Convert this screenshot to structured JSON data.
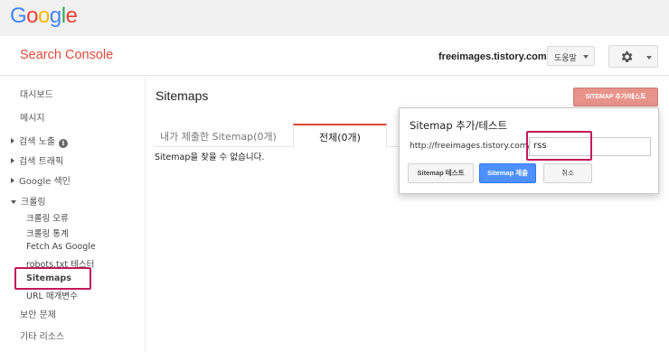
{
  "logo": {
    "letters": [
      "G",
      "o",
      "o",
      "g",
      "l",
      "e"
    ]
  },
  "colors": {
    "accent": "#dd4b39",
    "primary_button": "#4d90fe",
    "highlight": "#c2185b"
  },
  "header": {
    "app_title": "Search Console",
    "site": "freeimages.tistory.com",
    "help_label": "도움말",
    "settings_icon": "gear-icon"
  },
  "sidebar": {
    "dashboard": "대시보드",
    "messages": "메시지",
    "search_appearance": "검색 노출",
    "search_traffic": "검색 트래픽",
    "google_index": "Google 색인",
    "crawl": "크롤링",
    "crawl_errors": "크롤링 오류",
    "crawl_stats": "크롤링 통계",
    "fetch_as_google": "Fetch As Google",
    "robots_tester": "robots.txt 테스터",
    "sitemaps": "Sitemaps",
    "url_params": "URL 매개변수",
    "security": "보안 문제",
    "other_resources": "기타 리소스"
  },
  "main": {
    "title": "Sitemaps",
    "add_button": "SITEMAP 추가/테스트",
    "tabs": [
      {
        "label": "내가 제출한 Sitemap(0개)"
      },
      {
        "label": "전체(0개)"
      }
    ],
    "empty_message": "Sitemap을 찾을 수 없습니다."
  },
  "popup": {
    "title": "Sitemap 추가/테스트",
    "url_prefix": "http://freeimages.tistory.com/",
    "input_value": "rss",
    "test_button": "Sitemap 테스트",
    "submit_button": "Sitemap 제출",
    "cancel_button": "취소"
  }
}
